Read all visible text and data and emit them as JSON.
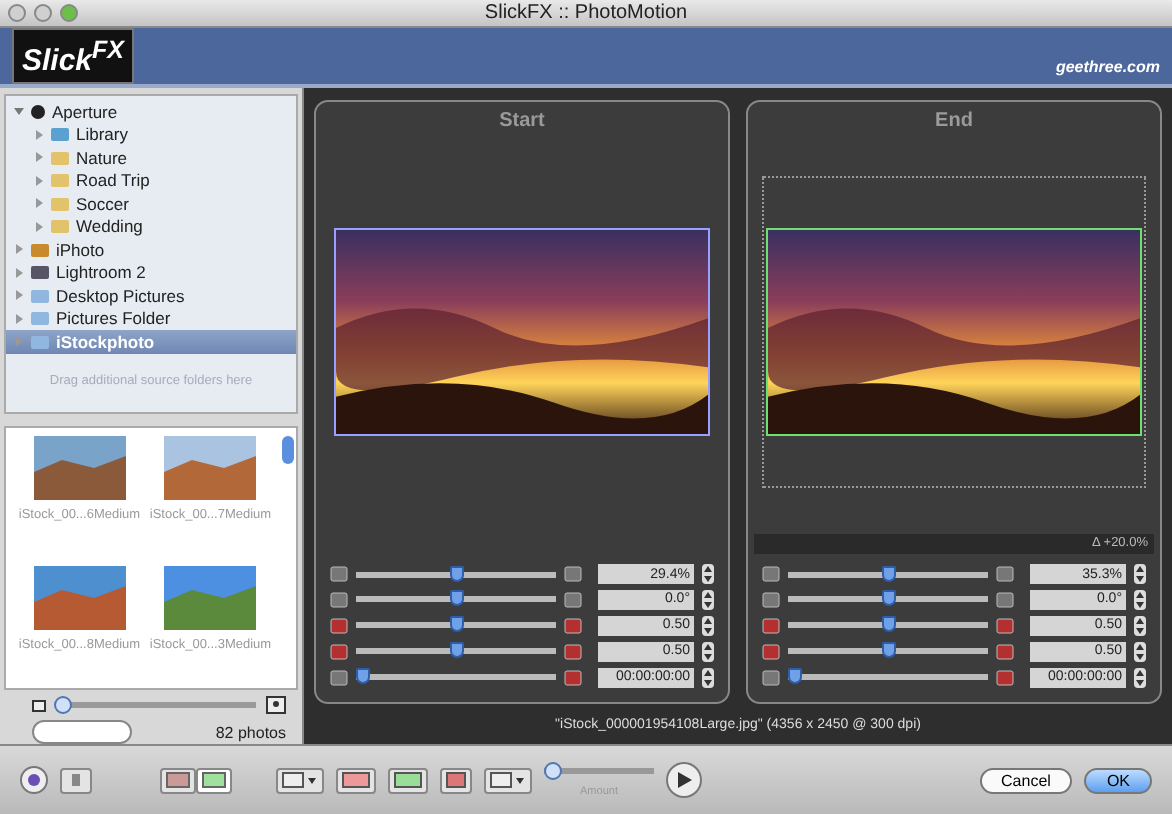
{
  "window": {
    "title": "SlickFX :: PhotoMotion"
  },
  "header": {
    "logo": "Slick",
    "logo_sup": "FX",
    "site": "geethree.com"
  },
  "sources": {
    "items": [
      {
        "label": "Aperture",
        "kind": "aperture",
        "expanded": true,
        "selected": false,
        "children": [
          {
            "label": "Library",
            "kind": "library",
            "expanded": false,
            "selected": false
          },
          {
            "label": "Nature",
            "kind": "album",
            "expanded": false,
            "selected": false
          },
          {
            "label": "Road Trip",
            "kind": "album",
            "expanded": false,
            "selected": false
          },
          {
            "label": "Soccer",
            "kind": "album",
            "expanded": false,
            "selected": false
          },
          {
            "label": "Wedding",
            "kind": "album",
            "expanded": false,
            "selected": false
          }
        ]
      },
      {
        "label": "iPhoto",
        "kind": "iphoto",
        "expanded": false,
        "selected": false
      },
      {
        "label": "Lightroom 2",
        "kind": "lightroom",
        "expanded": false,
        "selected": false
      },
      {
        "label": "Desktop Pictures",
        "kind": "folder",
        "expanded": false,
        "selected": false
      },
      {
        "label": "Pictures Folder",
        "kind": "folder",
        "expanded": false,
        "selected": false
      },
      {
        "label": "iStockphoto",
        "kind": "folder",
        "expanded": false,
        "selected": true
      }
    ],
    "hint": "Drag additional source folders here"
  },
  "thumbnails": [
    {
      "name": "iStock_00...6Medium"
    },
    {
      "name": "iStock_00...7Medium"
    },
    {
      "name": "iStock_00...8Medium"
    },
    {
      "name": "iStock_00...3Medium"
    }
  ],
  "thumb_size": {
    "level": 0.03
  },
  "photo_count": "82 photos",
  "panels": [
    {
      "title": "Start",
      "rows": [
        {
          "kind": "zoom",
          "level": 0.5,
          "value": "29.4%"
        },
        {
          "kind": "rotate",
          "level": 0.5,
          "value": "0.0°"
        },
        {
          "kind": "center-x",
          "level": 0.5,
          "value": "0.50"
        },
        {
          "kind": "center-y",
          "level": 0.5,
          "value": "0.50"
        },
        {
          "kind": "time",
          "level": 0.03,
          "value": "00:00:00:00"
        }
      ]
    },
    {
      "title": "End",
      "delta": "Δ +20.0%",
      "rows": [
        {
          "kind": "zoom",
          "level": 0.5,
          "value": "35.3%"
        },
        {
          "kind": "rotate",
          "level": 0.5,
          "value": "0.0°"
        },
        {
          "kind": "center-x",
          "level": 0.5,
          "value": "0.50"
        },
        {
          "kind": "center-y",
          "level": 0.5,
          "value": "0.50"
        },
        {
          "kind": "time",
          "level": 0.03,
          "value": "00:00:00:00"
        }
      ]
    }
  ],
  "caption": "\"iStock_000001954108Large.jpg\" (4356 x 2450 @ 300 dpi)",
  "toolbar": {
    "views": [
      {
        "selected": false
      },
      {
        "selected": true
      }
    ],
    "amount": {
      "label": "Amount",
      "level": 0.0
    },
    "buttons": [
      "Cancel",
      "OK"
    ]
  }
}
